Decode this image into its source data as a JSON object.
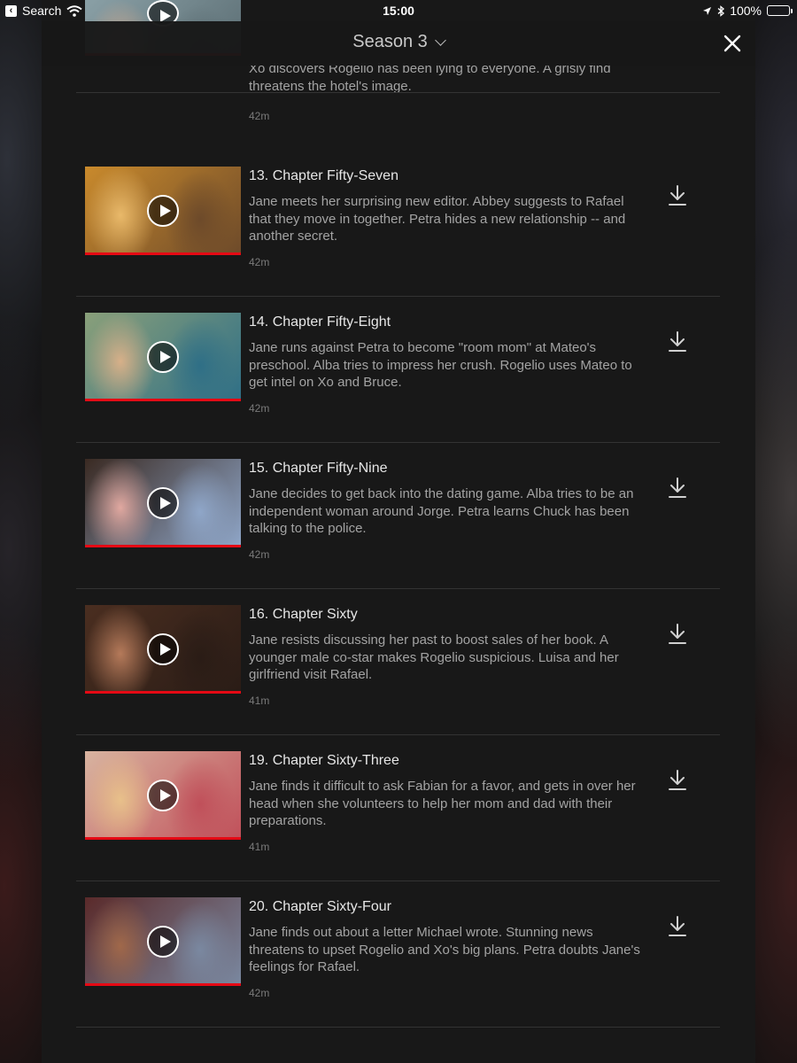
{
  "status_bar": {
    "back_label": "Search",
    "time": "15:00",
    "battery": "100%"
  },
  "header": {
    "season": "Season 3"
  },
  "episodes": [
    {
      "title": "",
      "description": "Xo discovers Rogelio has been lying to everyone. A grisly find threatens the hotel's image.",
      "duration": "42m",
      "thumb_colors": [
        "#8aa0a6",
        "#c9a890",
        "#5c6e74"
      ]
    },
    {
      "title": "13. Chapter Fifty-Seven",
      "description": "Jane meets her surprising new editor. Abbey suggests to Rafael that they move in together. Petra hides a new relationship -- and another secret.",
      "duration": "42m",
      "thumb_colors": [
        "#c98a2c",
        "#e9b96a",
        "#6d4a2a"
      ]
    },
    {
      "title": "14. Chapter Fifty-Eight",
      "description": "Jane runs against Petra to become \"room mom\" at Mateo's preschool. Alba tries to impress her crush. Rogelio uses Mateo to get intel on Xo and Bruce.",
      "duration": "42m",
      "thumb_colors": [
        "#8aa07a",
        "#d7b089",
        "#2f6f86"
      ]
    },
    {
      "title": "15. Chapter Fifty-Nine",
      "description": "Jane decides to get back into the dating game. Alba tries to be an independent woman around Jorge. Petra learns Chuck has been talking to the police.",
      "duration": "42m",
      "thumb_colors": [
        "#3a2a22",
        "#e0a8a0",
        "#8fa6c8"
      ]
    },
    {
      "title": "16. Chapter Sixty",
      "description": "Jane resists discussing her past to boost sales of her book. A younger male co-star makes Rogelio suspicious. Luisa and her girlfriend visit Rafael.",
      "duration": "41m",
      "thumb_colors": [
        "#4a2e20",
        "#b57a5a",
        "#2a1c16"
      ]
    },
    {
      "title": "19. Chapter Sixty-Three",
      "description": "Jane finds it difficult to ask Fabian for a favor, and gets in over her head when she volunteers to help her mom and dad with their preparations.",
      "duration": "41m",
      "thumb_colors": [
        "#d8b4a0",
        "#e8c08a",
        "#c0505a"
      ]
    },
    {
      "title": "20. Chapter Sixty-Four",
      "description": "Jane finds out about a letter Michael wrote. Stunning news threatens to upset Rogelio and Xo's big plans. Petra doubts Jane's feelings for Rafael.",
      "duration": "42m",
      "thumb_colors": [
        "#5a2a2a",
        "#a0684a",
        "#7a88a0"
      ]
    }
  ]
}
